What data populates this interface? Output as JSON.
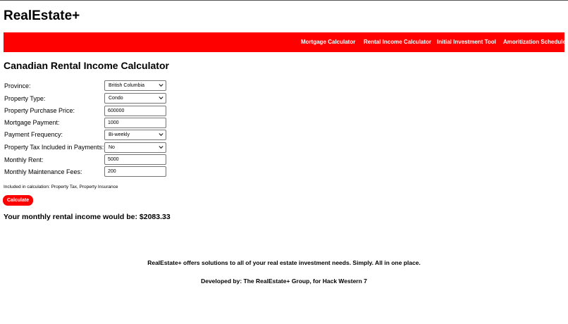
{
  "site": {
    "title": "RealEstate+"
  },
  "nav": {
    "items": [
      {
        "label": "Mortgage Calculator"
      },
      {
        "label": "Rental Income Calculator"
      },
      {
        "label": "Initial Investment Tool"
      },
      {
        "label": "Amoritization Schedule"
      }
    ]
  },
  "colors": {
    "accent": "#ff0000",
    "nav_text": "#ffffff"
  },
  "page": {
    "heading": "Canadian Rental Income Calculator"
  },
  "form": {
    "province": {
      "label": "Province:",
      "value": "British Columbia"
    },
    "property_type": {
      "label": "Property Type:",
      "value": "Condo"
    },
    "purchase_price": {
      "label": "Property Purchase Price:",
      "value": "600000"
    },
    "mortgage_payment": {
      "label": "Mortgage Payment:",
      "value": "1000"
    },
    "payment_frequency": {
      "label": "Payment Frequency:",
      "value": "Bi-weekly"
    },
    "tax_included": {
      "label": "Property Tax Included in Payments:",
      "value": "No"
    },
    "monthly_rent": {
      "label": "Monthly Rent:",
      "value": "5000"
    },
    "maintenance_fees": {
      "label": "Monthly Maintenance Fees:",
      "value": "200"
    }
  },
  "note": {
    "text": "Included in calculation: Property Tax, Property Insurance"
  },
  "actions": {
    "calculate_label": "Calculate"
  },
  "result": {
    "text": "Your monthly rental income would be: $2083.33"
  },
  "footer": {
    "tagline": "RealEstate+ offers solutions to all of your real estate investment needs. Simply. All in one place.",
    "credits": "Developed by: The RealEstate+ Group, for Hack Western 7"
  },
  "icons": {
    "select_arrow": "chevron-down-icon"
  }
}
